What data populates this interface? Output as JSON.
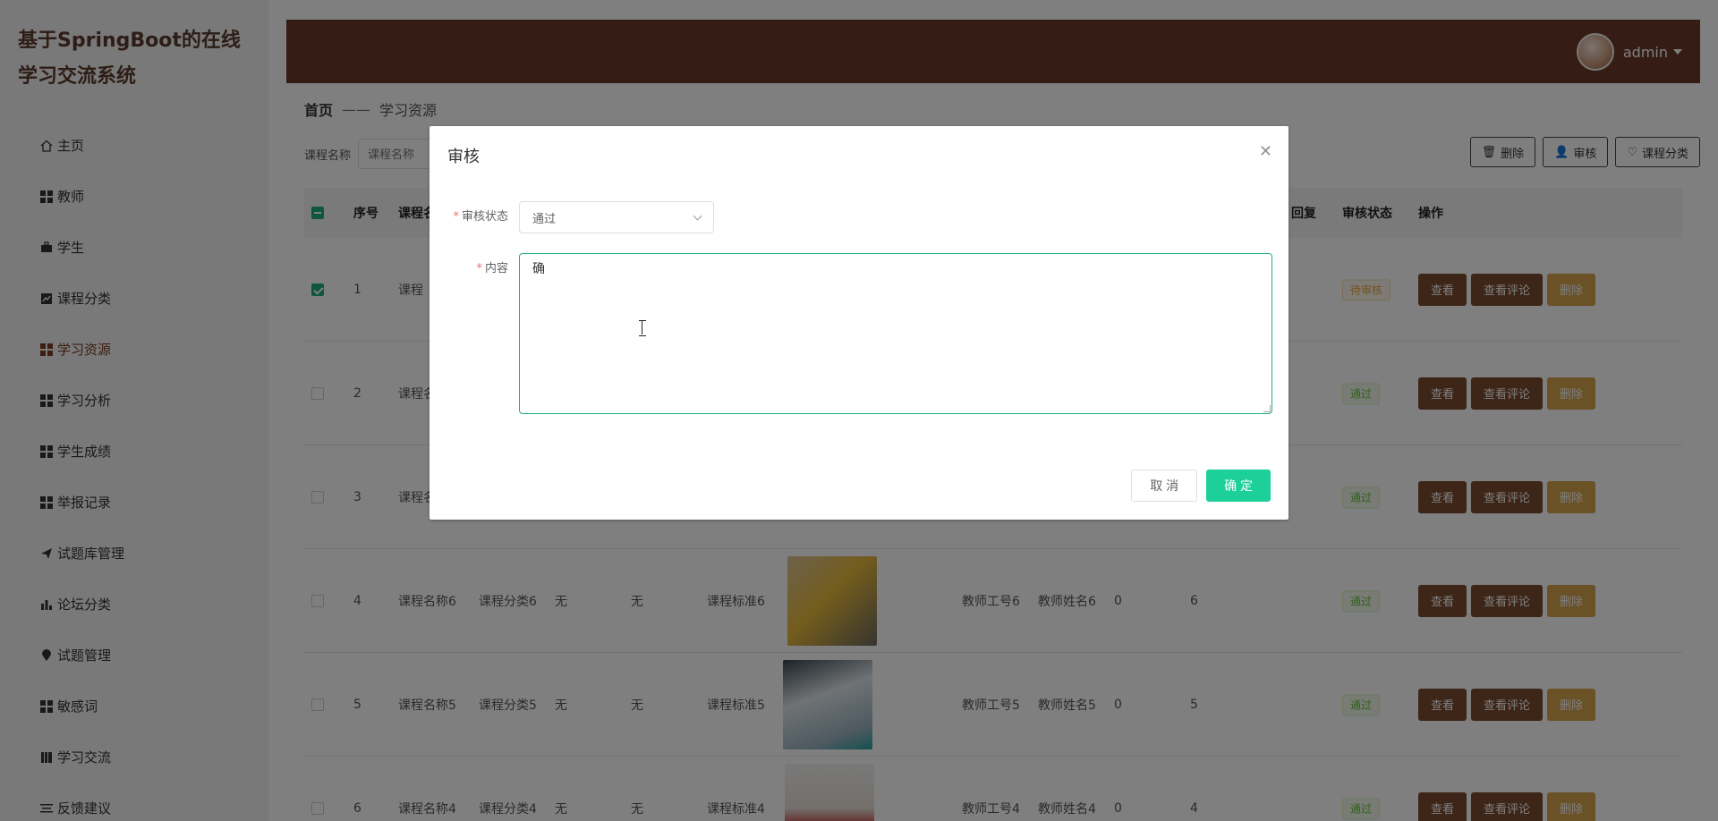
{
  "brand": {
    "title": "基于SpringBoot的在线学习交流系统"
  },
  "sidebar": {
    "items": [
      {
        "label": "主页",
        "icon": "home-icon"
      },
      {
        "label": "教师",
        "icon": "grid-icon"
      },
      {
        "label": "学生",
        "icon": "briefcase-icon"
      },
      {
        "label": "课程分类",
        "icon": "chart-icon"
      },
      {
        "label": "学习资源",
        "icon": "grid-icon"
      },
      {
        "label": "学习分析",
        "icon": "grid-icon"
      },
      {
        "label": "学生成绩",
        "icon": "grid-icon"
      },
      {
        "label": "举报记录",
        "icon": "grid-icon"
      },
      {
        "label": "试题库管理",
        "icon": "send-icon"
      },
      {
        "label": "论坛分类",
        "icon": "bar-chart-icon"
      },
      {
        "label": "试题管理",
        "icon": "pin-icon"
      },
      {
        "label": "敏感词",
        "icon": "grid-icon"
      },
      {
        "label": "学习交流",
        "icon": "book-icon"
      },
      {
        "label": "反馈建议",
        "icon": "list-icon"
      }
    ]
  },
  "header": {
    "username": "admin"
  },
  "breadcrumb": {
    "home": "首页",
    "sep": "——",
    "current": "学习资源"
  },
  "filter": {
    "label": "课程名称",
    "placeholder": "课程名称"
  },
  "toolbar": {
    "delete": "删除",
    "audit": "审核",
    "category": "课程分类"
  },
  "table": {
    "headers": {
      "index": "序号",
      "course": "课程名",
      "reply": "回复",
      "status": "审核状态",
      "ops": "操作"
    },
    "rows": [
      {
        "index": "1",
        "name": "课程",
        "status": "待审核",
        "checked": true
      },
      {
        "index": "2",
        "name": "课程名",
        "status": "通过",
        "checked": false
      },
      {
        "index": "3",
        "name": "课程名",
        "status": "通过",
        "checked": false
      },
      {
        "index": "4",
        "name": "课程名称6",
        "category": "课程分类6",
        "a": "无",
        "b": "无",
        "standard": "课程标准6",
        "teacherNo": "教师工号6",
        "teacherName": "教师姓名6",
        "c": "0",
        "d": "6",
        "status": "通过",
        "checked": false
      },
      {
        "index": "5",
        "name": "课程名称5",
        "category": "课程分类5",
        "a": "无",
        "b": "无",
        "standard": "课程标准5",
        "teacherNo": "教师工号5",
        "teacherName": "教师姓名5",
        "c": "0",
        "d": "5",
        "status": "通过",
        "checked": false
      },
      {
        "index": "6",
        "name": "课程名称4",
        "category": "课程分类4",
        "a": "无",
        "b": "无",
        "standard": "课程标准4",
        "teacherNo": "教师工号4",
        "teacherName": "教师姓名4",
        "c": "0",
        "d": "4",
        "status": "通过",
        "checked": false
      }
    ],
    "ops": {
      "view": "查看",
      "comment": "查看评论",
      "delete": "删除"
    }
  },
  "dialog": {
    "title": "审核",
    "status_label": "审核状态",
    "status_value": "通过",
    "content_label": "内容",
    "content_value": "确",
    "cancel": "取 消",
    "confirm": "确 定"
  },
  "colors": {
    "brand": "#6b3a2a",
    "accent": "#1dd09a",
    "danger": "#d4a24c"
  }
}
